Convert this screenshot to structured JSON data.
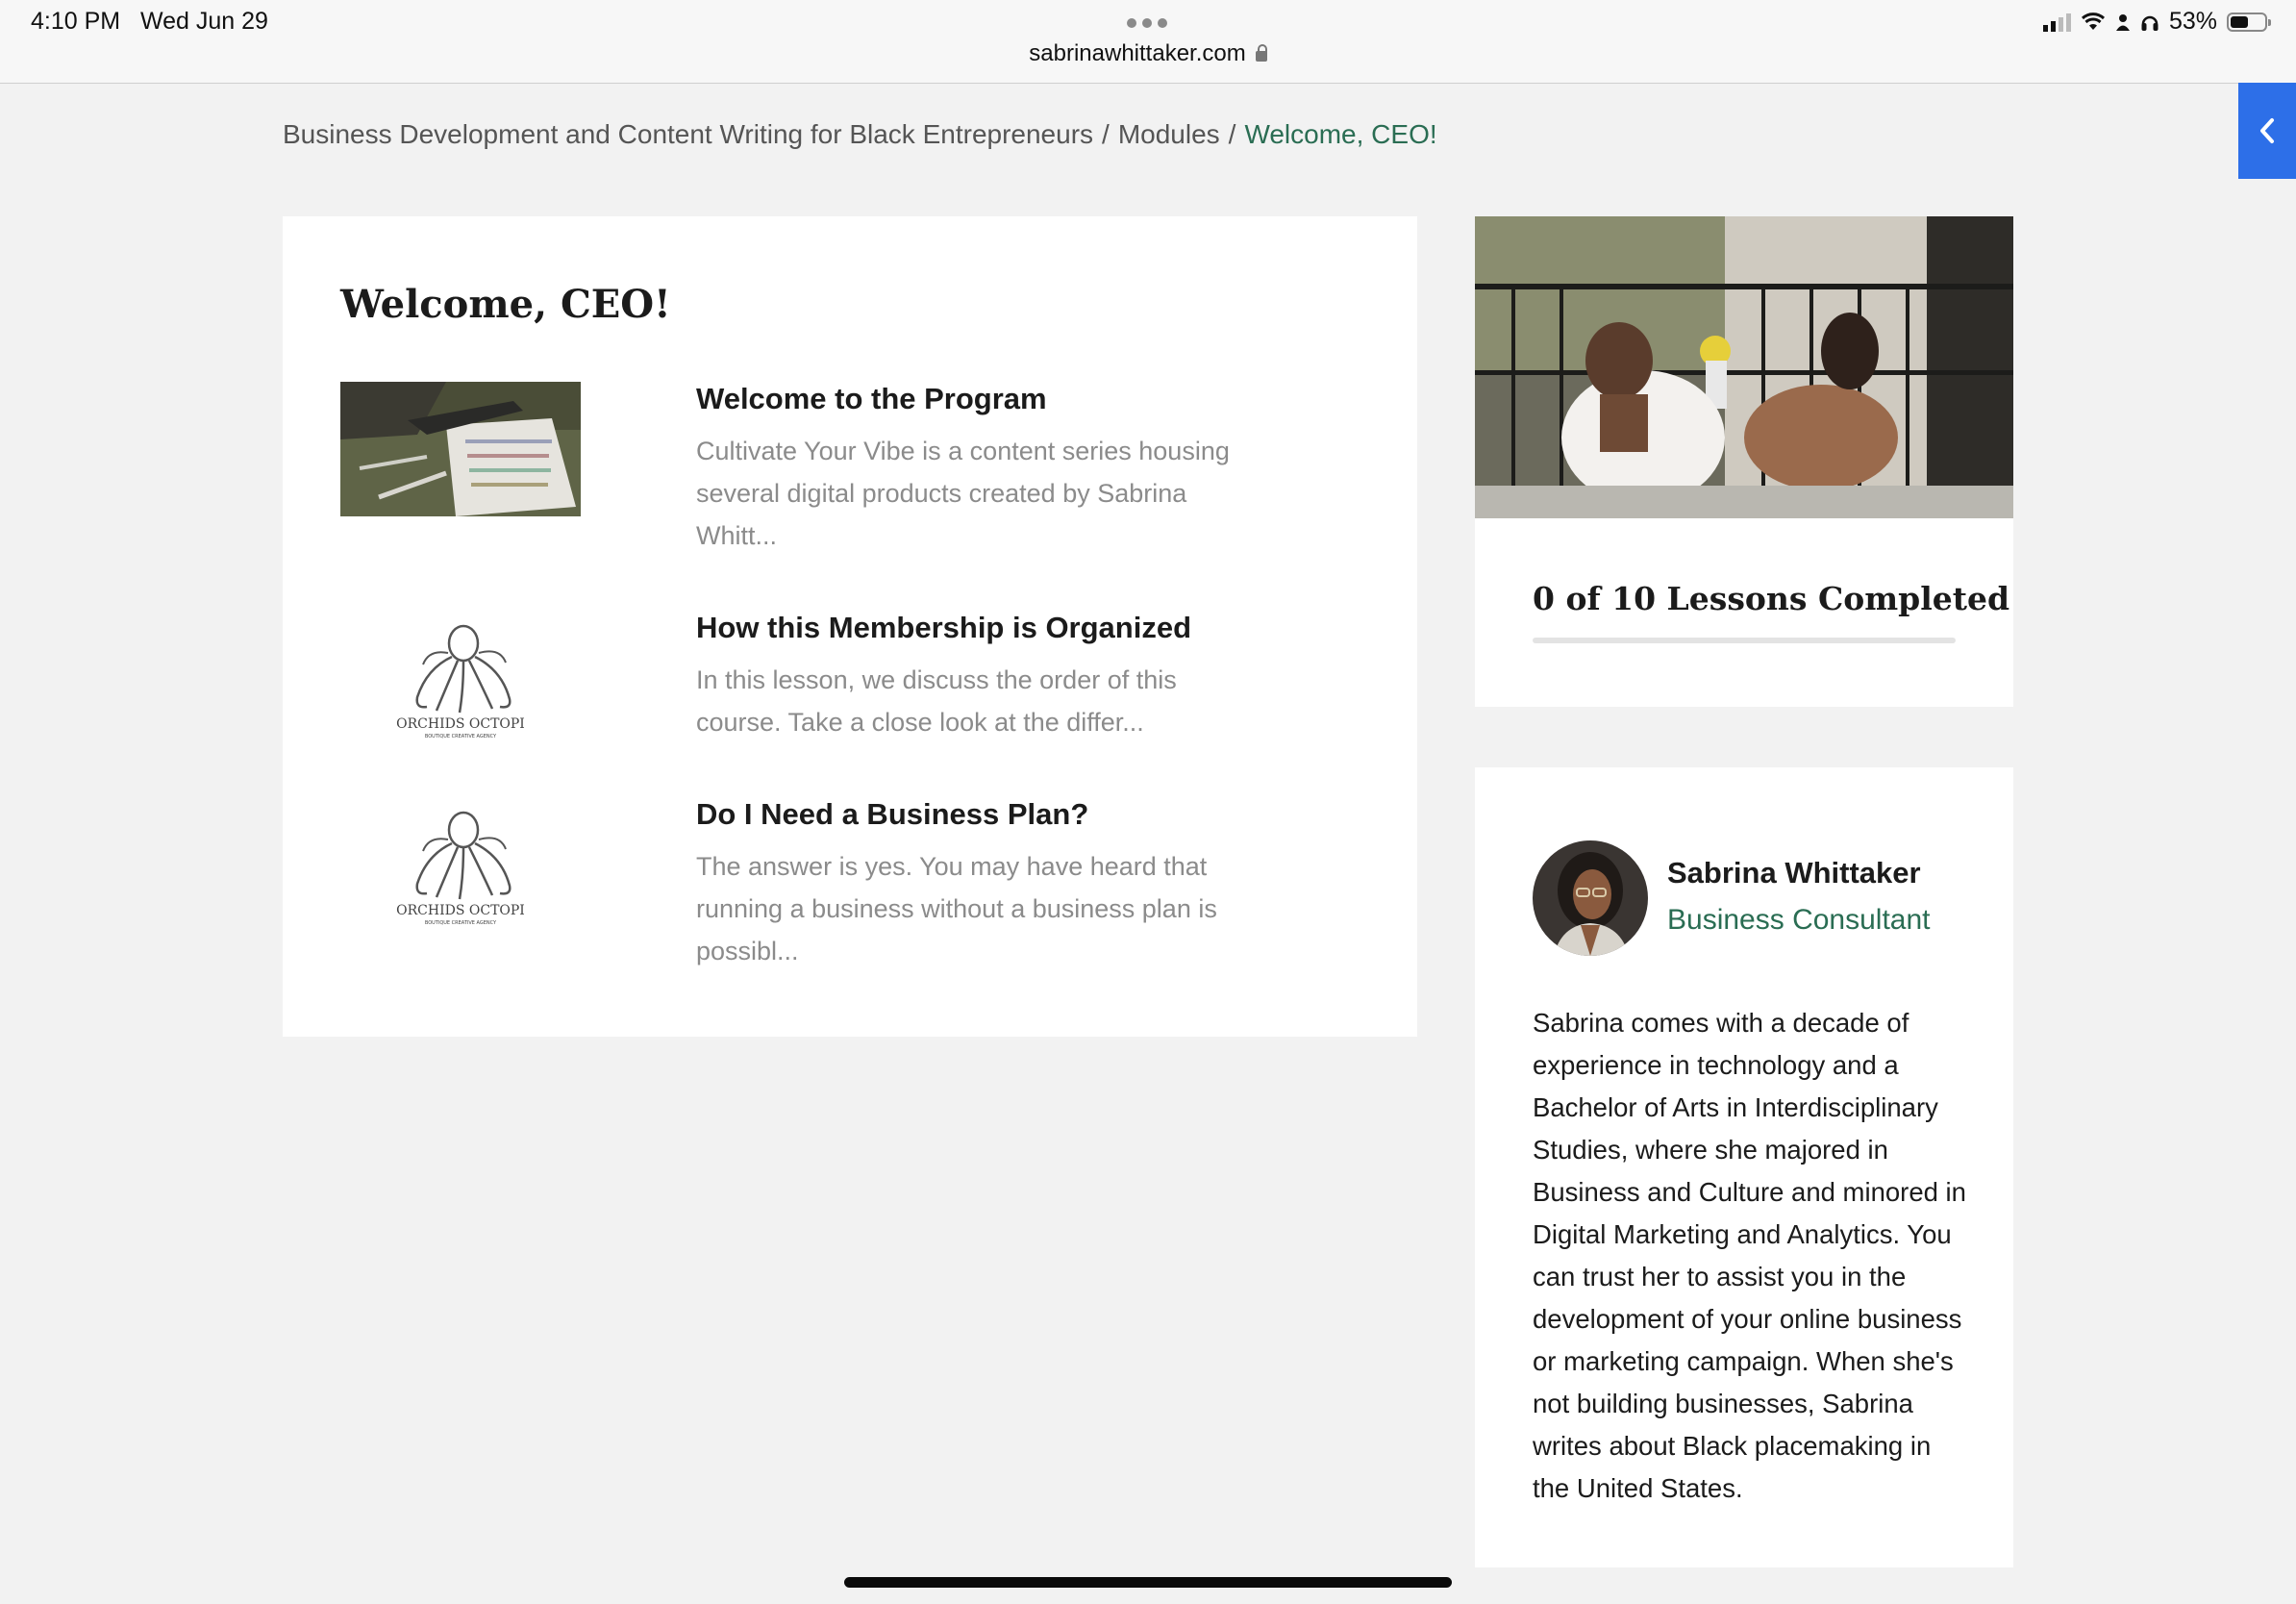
{
  "status_bar": {
    "time": "4:10 PM",
    "date": "Wed Jun 29",
    "url": "sabrinawhittaker.com",
    "battery": "53%",
    "battery_level": 0.53
  },
  "breadcrumb": {
    "items": [
      "Business Development and Content Writing for Black Entrepreneurs",
      "Modules"
    ],
    "separator": "/",
    "current": "Welcome, CEO!"
  },
  "module": {
    "title": "Welcome, CEO!",
    "lessons": [
      {
        "title": "Welcome to the Program",
        "excerpt": "Cultivate Your Vibe is a content series housing several digital products created by Sabrina Whitt...",
        "thumbnail": "photo-thumbnail"
      },
      {
        "title": "How this Membership is Organized",
        "excerpt": "In this lesson, we discuss the order of this course.    Take a close look at the differ...",
        "thumbnail": "octopus-logo"
      },
      {
        "title": "Do I Need a Business Plan?",
        "excerpt": "The answer is yes. You may have heard that running a business without a business plan is possibl...",
        "thumbnail": "octopus-logo"
      }
    ],
    "logo_text": "ORCHIDS OCTOPI",
    "logo_subtext": "BOUTIQUE CREATIVE AGENCY"
  },
  "progress": {
    "label": "0 of 10 Lessons Completed",
    "completed": 0,
    "total": 10
  },
  "author": {
    "name": "Sabrina Whittaker",
    "role": "Business Consultant",
    "bio": "Sabrina comes with a decade of experience in technology and a Bachelor of Arts in Interdisciplinary Studies, where she majored in Business and Culture and minored in Digital Marketing and Analytics. You can trust her to assist you in the development of your online business or marketing campaign. When she's not building businesses, Sabrina writes about Black placemaking in the United States."
  },
  "colors": {
    "accent_green": "#2a6d53",
    "side_tab_blue": "#2d6fe8",
    "background": "#f2f2f2"
  },
  "icons": {
    "side_tab": "chevron-left-icon"
  }
}
